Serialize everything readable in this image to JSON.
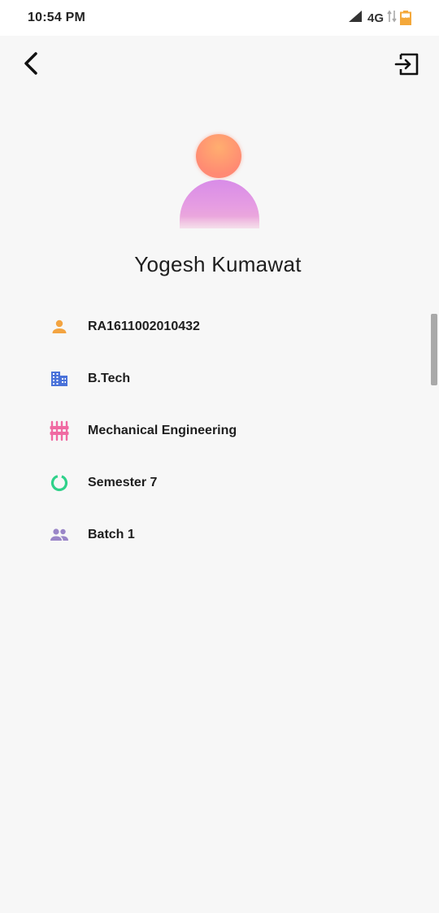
{
  "status_bar": {
    "time": "10:54 PM",
    "network": "4G",
    "battery": "37",
    "icons": [
      "signal-icon",
      "data-arrows-icon",
      "battery-icon"
    ]
  },
  "app_bar": {
    "back_icon": "back-arrow-icon",
    "logout_icon": "logout-icon"
  },
  "profile": {
    "name": "Yogesh Kumawat",
    "avatar_colors": {
      "head": "#ff9a70",
      "body": "#dc95e6"
    }
  },
  "info": [
    {
      "icon": "person-icon",
      "color": "#f3a441",
      "text": "RA1611002010432"
    },
    {
      "icon": "building-icon",
      "color": "#4a72d9",
      "text": "B.Tech"
    },
    {
      "icon": "tune-icon",
      "color": "#f06aa2",
      "text": "Mechanical Engineering"
    },
    {
      "icon": "progress-ring-icon",
      "color": "#2fd18a",
      "text": "Semester 7"
    },
    {
      "icon": "group-icon",
      "color": "#9a86c8",
      "text": "Batch 1"
    }
  ]
}
